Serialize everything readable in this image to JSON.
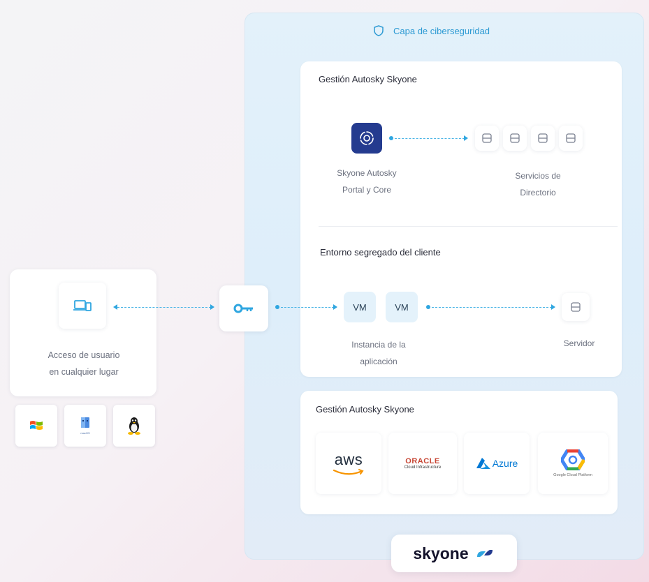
{
  "security_layer": {
    "label": "Capa de ciberseguridad"
  },
  "management": {
    "title": "Gestión Autosky Skyone",
    "portal_label_1": "Skyone Autosky",
    "portal_label_2": "Portal y Core",
    "directory_label_1": "Servicios de",
    "directory_label_2": "Directorio"
  },
  "client_env": {
    "title": "Entorno segregado del cliente",
    "vm1": "VM",
    "vm2": "VM",
    "instance_label_1": "Instancia de la",
    "instance_label_2": "aplicación",
    "server_label": "Servidor"
  },
  "clouds": {
    "title": "Gestión Autosky Skyone",
    "aws": "aws",
    "oracle_1": "ORACLE",
    "oracle_2": "Cloud Infrastructure",
    "azure": "Azure",
    "gcp": "Google Cloud Platform"
  },
  "user_access": {
    "label_1": "Acceso de usuario",
    "label_2": "en cualquier lugar"
  },
  "os": {
    "mac_small": "macOS"
  },
  "brand": {
    "name": "skyone"
  },
  "icons": [
    "shield-icon",
    "skyone-autosky-icon",
    "server-icon",
    "devices-icon",
    "key-icon",
    "windows-icon",
    "mac-icon",
    "linux-icon",
    "aws-logo",
    "oracle-logo",
    "azure-logo",
    "gcp-logo",
    "skyone-logo"
  ],
  "colors": {
    "accent": "#2fa6e0",
    "portal_tile": "#243b8f",
    "security_label": "#2c9ad3"
  }
}
